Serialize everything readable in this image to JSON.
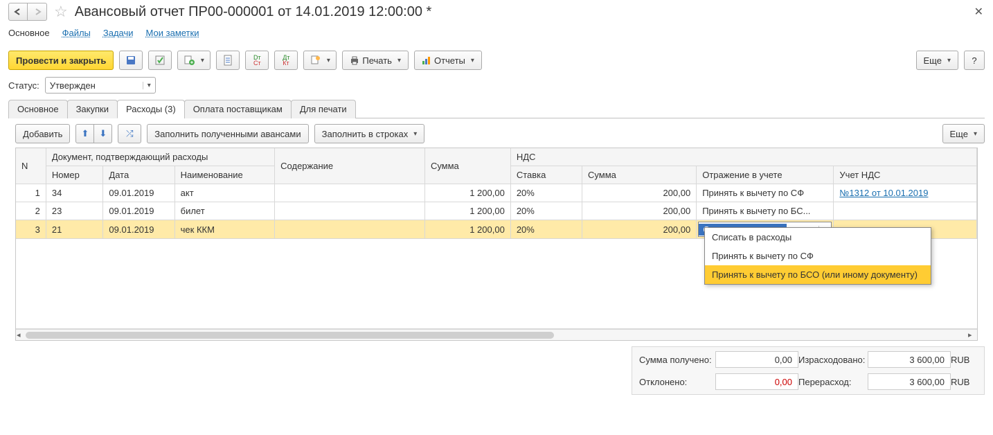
{
  "header": {
    "title": "Авансовый отчет ПР00-000001 от 14.01.2019 12:00:00 *"
  },
  "navTabs": {
    "main": "Основное",
    "files": "Файлы",
    "tasks": "Задачи",
    "notes": "Мои заметки"
  },
  "toolbar": {
    "postAndClose": "Провести и закрыть",
    "print": "Печать",
    "reports": "Отчеты",
    "more": "Еще",
    "help": "?"
  },
  "status": {
    "label": "Статус:",
    "value": "Утвержден"
  },
  "innerTabs": {
    "main": "Основное",
    "purchases": "Закупки",
    "expenses": "Расходы (3)",
    "supplierPay": "Оплата поставщикам",
    "forPrint": "Для печати"
  },
  "tableToolbar": {
    "add": "Добавить",
    "fillAdvances": "Заполнить полученными авансами",
    "fillRows": "Заполнить в строках",
    "more": "Еще"
  },
  "columns": {
    "n": "N",
    "docGroup": "Документ, подтверждающий расходы",
    "number": "Номер",
    "date": "Дата",
    "name": "Наименование",
    "content": "Содержание",
    "sum": "Сумма",
    "vatGroup": "НДС",
    "rate": "Ставка",
    "vatSum": "Сумма",
    "reflection": "Отражение в учете",
    "vatAcc": "Учет НДС"
  },
  "rows": [
    {
      "n": "1",
      "num": "34",
      "date": "09.01.2019",
      "name": "акт",
      "sum": "1 200,00",
      "rate": "20%",
      "vat": "200,00",
      "refl": "Принять к вычету по СФ",
      "vatAcc": "№1312 от 10.01.2019"
    },
    {
      "n": "2",
      "num": "23",
      "date": "09.01.2019",
      "name": "билет",
      "sum": "1 200,00",
      "rate": "20%",
      "vat": "200,00",
      "refl": "Принять к вычету по БС...",
      "vatAcc": ""
    },
    {
      "n": "3",
      "num": "21",
      "date": "09.01.2019",
      "name": "чек ККМ",
      "sum": "1 200,00",
      "rate": "20%",
      "vat": "200,00",
      "refl": "Списать в расходы",
      "vatAcc": ""
    }
  ],
  "dropdown": {
    "opt1": "Списать в расходы",
    "opt2": "Принять к вычету по СФ",
    "opt3": "Принять к вычету по БСО (или иному документу)"
  },
  "totals": {
    "receivedLabel": "Сумма получено:",
    "received": "0,00",
    "spentLabel": "Израсходовано:",
    "spent": "3 600,00",
    "rejectedLabel": "Отклонено:",
    "rejected": "0,00",
    "overLabel": "Перерасход:",
    "over": "3 600,00",
    "currency": "RUB"
  }
}
